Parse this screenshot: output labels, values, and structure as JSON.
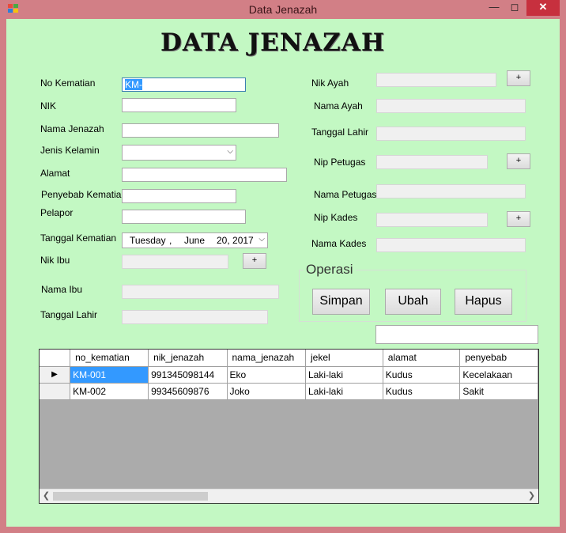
{
  "window": {
    "title": "Data Jenazah"
  },
  "heading": "DATA JENAZAH",
  "left_form": {
    "no_kematian": {
      "label": "No Kematian",
      "value": "KM-"
    },
    "nik": {
      "label": "NIK",
      "value": ""
    },
    "nama_jenazah": {
      "label": "Nama Jenazah",
      "value": ""
    },
    "jenis_kelamin": {
      "label": "Jenis Kelamin",
      "value": ""
    },
    "alamat": {
      "label": "Alamat",
      "value": ""
    },
    "penyebab_kematian": {
      "label": "Penyebab Kematian",
      "value": ""
    },
    "pelapor": {
      "label": "Pelapor",
      "value": ""
    },
    "tanggal_kematian": {
      "label": "Tanggal Kematian",
      "day": "Tuesday",
      "month": "June",
      "date": "20, 2017"
    },
    "nik_ibu": {
      "label": "Nik Ibu",
      "value": "",
      "button": "+"
    },
    "nama_ibu": {
      "label": "Nama Ibu",
      "value": ""
    },
    "tanggal_lahir": {
      "label": "Tanggal Lahir",
      "value": ""
    }
  },
  "right_form": {
    "nik_ayah": {
      "label": "Nik Ayah",
      "value": "",
      "button": "+"
    },
    "nama_ayah": {
      "label": "Nama Ayah",
      "value": ""
    },
    "tanggal_lahir": {
      "label": "Tanggal Lahir",
      "value": ""
    },
    "nip_petugas": {
      "label": "Nip Petugas",
      "value": "",
      "button": "+"
    },
    "nama_petugas": {
      "label": "Nama Petugas",
      "value": ""
    },
    "nip_kades": {
      "label": "Nip Kades",
      "value": "",
      "button": "+"
    },
    "nama_kades": {
      "label": "Nama Kades",
      "value": ""
    }
  },
  "operasi": {
    "title": "Operasi",
    "simpan": "Simpan",
    "ubah": "Ubah",
    "hapus": "Hapus",
    "search_value": ""
  },
  "grid": {
    "columns": [
      "no_kematian",
      "nik_jenazah",
      "nama_jenazah",
      "jekel",
      "alamat",
      "penyebab"
    ],
    "rows": [
      {
        "current": true,
        "cells": [
          "KM-001",
          "991345098144",
          "Eko",
          "Laki-laki",
          "Kudus",
          "Kecelakaan"
        ]
      },
      {
        "current": false,
        "cells": [
          "KM-002",
          "99345609876",
          "Joko",
          "Laki-laki",
          "Kudus",
          "Sakit"
        ]
      }
    ]
  },
  "colors": {
    "title_bar": "#d27f86",
    "form_background": "#c3f8c3",
    "selection": "#3399ff"
  },
  "icons": {
    "minimize": "minimize-icon",
    "maximize": "maximize-icon",
    "close": "close-icon",
    "current_row": "triangle-right-icon"
  }
}
